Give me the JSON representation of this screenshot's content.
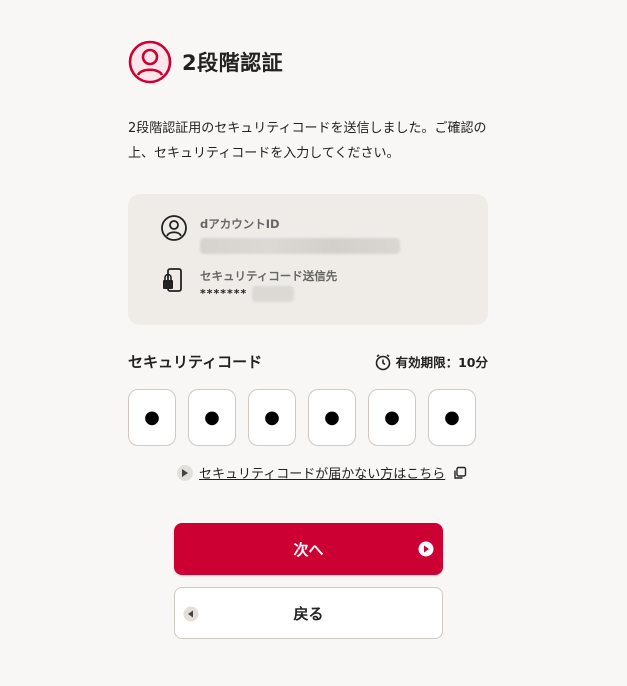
{
  "header": {
    "title": "2段階認証",
    "icon": "user-circle-icon",
    "accent_color": "#cc0033"
  },
  "description": "2段階認証用のセキュリティコードを送信しました。ご確認の上、セキュリティコードを入力してください。",
  "account_card": {
    "account_id_label": "dアカウントID",
    "account_id_icon": "user-circle-icon",
    "destination_label": "セキュリティコード送信先",
    "destination_icon": "phone-lock-icon",
    "destination_value": "*******"
  },
  "code_section": {
    "label": "セキュリティコード",
    "expiry_text": "有効期限：10分",
    "expiry_icon": "timer-icon",
    "digits": [
      "●",
      "●",
      "●",
      "●",
      "●",
      "●"
    ]
  },
  "help_link": {
    "text": "セキュリティコードが届かない方はこちら",
    "icon": "external-window-icon"
  },
  "buttons": {
    "next_label": "次へ",
    "next_color": "#cc0033",
    "back_label": "戻る"
  }
}
